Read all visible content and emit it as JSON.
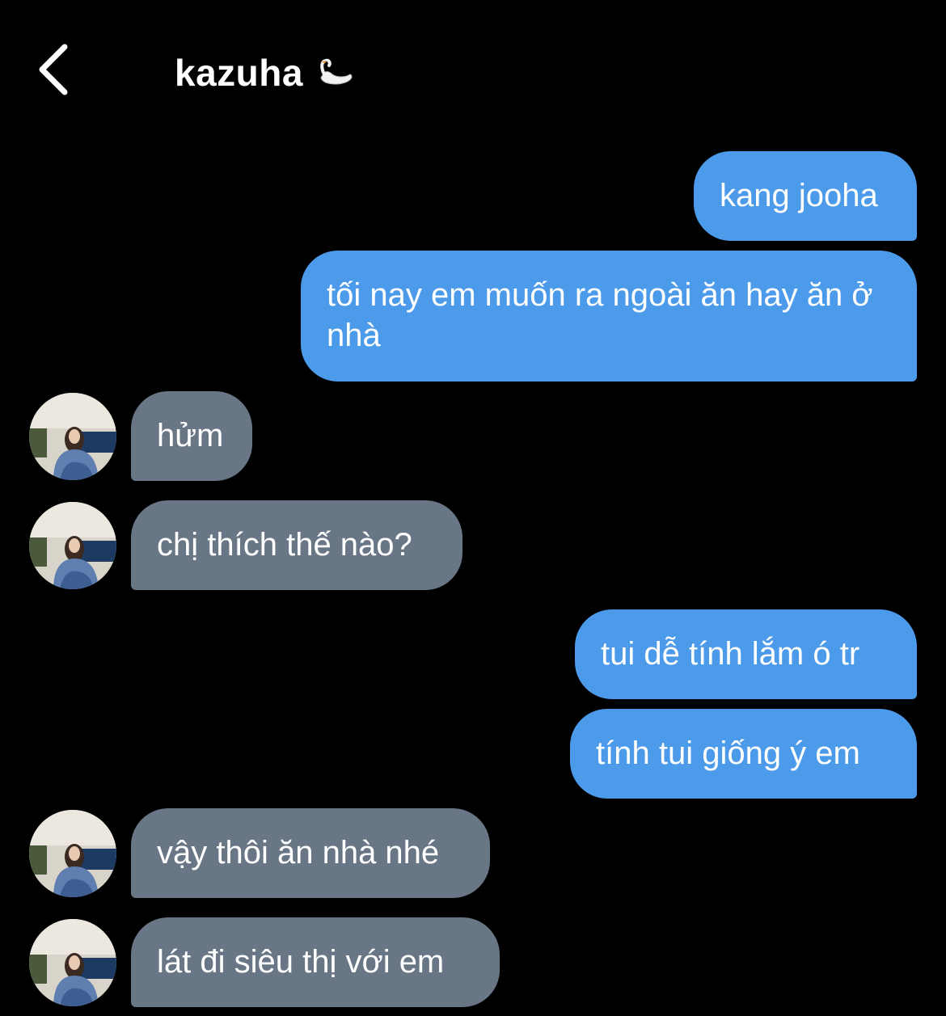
{
  "header": {
    "title": "kazuha",
    "title_icon": "swan-icon",
    "back_icon": "chevron-left-icon"
  },
  "messages": [
    {
      "sender": "me",
      "text": "kang jooha"
    },
    {
      "sender": "me",
      "text": "tối nay em muốn ra ngoài ăn hay ăn ở nhà"
    },
    {
      "sender": "kazuha",
      "text": "hửm"
    },
    {
      "sender": "kazuha",
      "text": "chị thích thế nào?"
    },
    {
      "sender": "me",
      "text": "tui dễ tính lắm ó tr"
    },
    {
      "sender": "me",
      "text": "tính tui giống ý em"
    },
    {
      "sender": "kazuha",
      "text": "vậy thôi ăn nhà nhé"
    },
    {
      "sender": "kazuha",
      "text": "lát đi siêu thị với em"
    }
  ],
  "colors": {
    "background": "#000000",
    "sent_bubble": "#4c9aea",
    "received_bubble": "#687685",
    "text": "#ffffff"
  }
}
